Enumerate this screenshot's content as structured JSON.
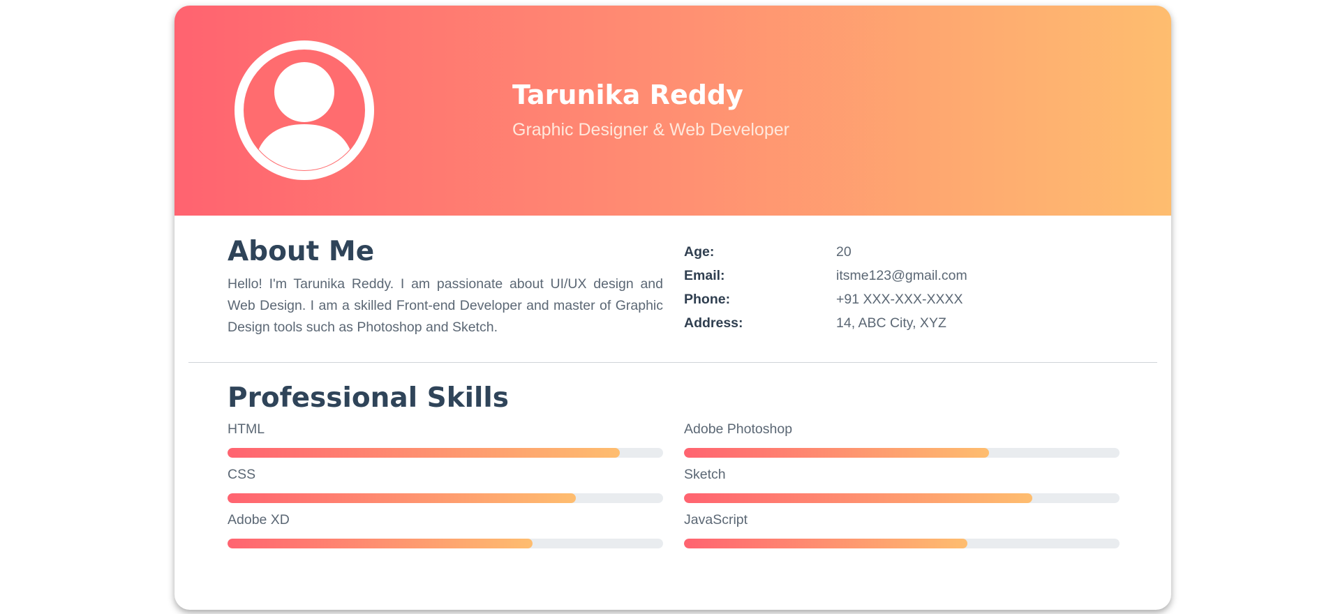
{
  "profile": {
    "name": "Tarunika Reddy",
    "title": "Graphic Designer & Web Developer",
    "avatar_icon": "user-avatar-icon"
  },
  "about": {
    "heading": "About Me",
    "text": "Hello! I'm Tarunika Reddy. I am passionate about UI/UX design and Web Design. I am a skilled Front-end Developer and master of Graphic Design tools such as Photoshop and Sketch."
  },
  "info": [
    {
      "label": "Age:",
      "value": "20"
    },
    {
      "label": "Email:",
      "value": "itsme123@gmail.com"
    },
    {
      "label": "Phone:",
      "value": "+91 XXX-XXX-XXXX"
    },
    {
      "label": "Address:",
      "value": "14, ABC City, XYZ"
    }
  ],
  "skills": {
    "heading": "Professional Skills",
    "items": [
      {
        "name": "HTML",
        "level": 0.9
      },
      {
        "name": "Adobe Photoshop",
        "level": 0.7
      },
      {
        "name": "CSS",
        "level": 0.8
      },
      {
        "name": "Sketch",
        "level": 0.8
      },
      {
        "name": "Adobe XD",
        "level": 0.7
      },
      {
        "name": "JavaScript",
        "level": 0.65
      }
    ]
  },
  "colors": {
    "gradient_start": "#ff6370",
    "gradient_end": "#febd6f",
    "heading": "#2f4459",
    "text": "#5b6774",
    "track": "#e9ecef"
  }
}
